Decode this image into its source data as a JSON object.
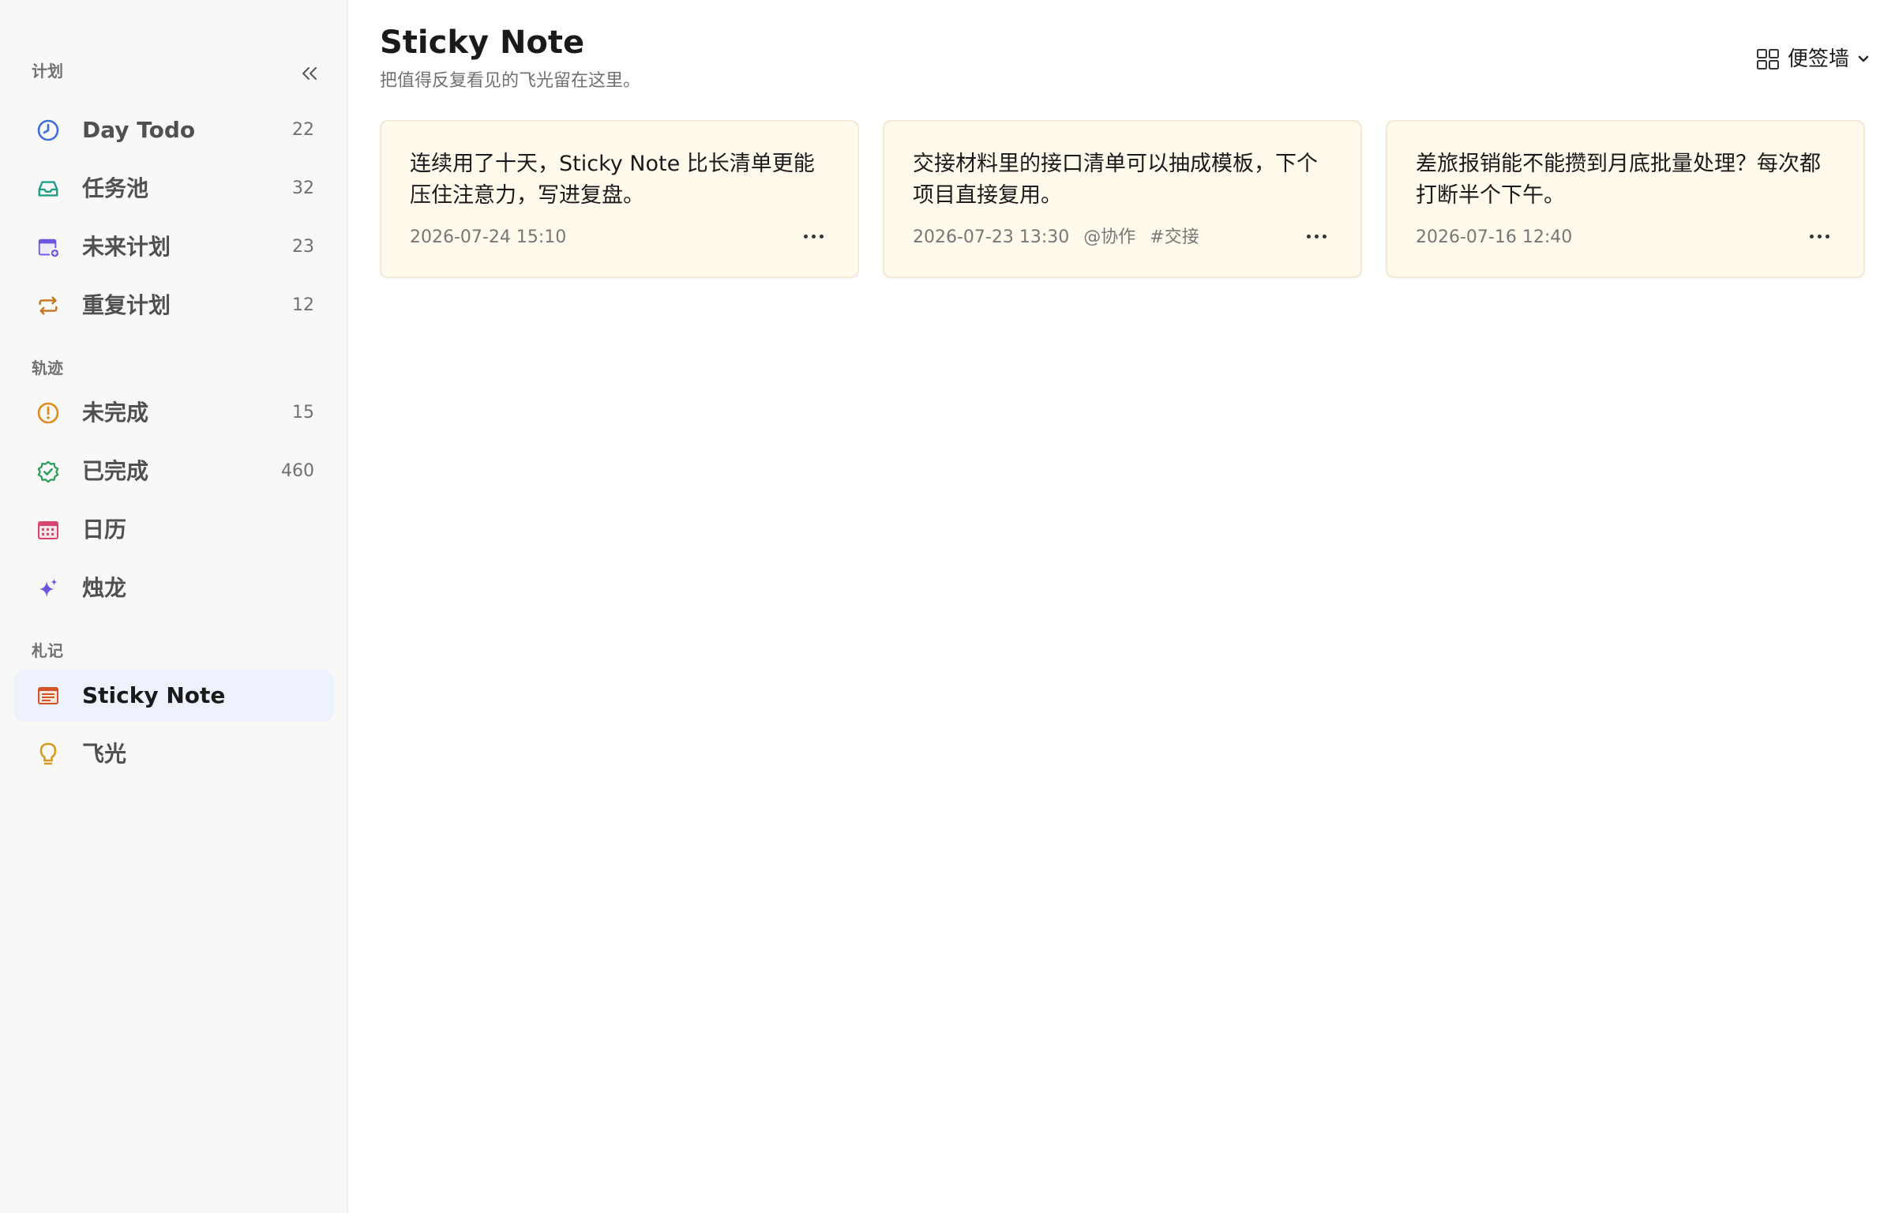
{
  "sidebar": {
    "sections": [
      {
        "label": "计划"
      },
      {
        "label": "轨迹"
      },
      {
        "label": "札记"
      }
    ],
    "items": [
      {
        "label": "Day Todo",
        "count": "22",
        "icon": "clock-icon",
        "color": "#3b6fd8"
      },
      {
        "label": "任务池",
        "count": "32",
        "icon": "inbox-icon",
        "color": "#1f9e86"
      },
      {
        "label": "未来计划",
        "count": "23",
        "icon": "calendar-plus-icon",
        "color": "#6c55e0"
      },
      {
        "label": "重复计划",
        "count": "12",
        "icon": "repeat-icon",
        "color": "#c9741c"
      },
      {
        "label": "未完成",
        "count": "15",
        "icon": "alert-circle-icon",
        "color": "#e08a1c"
      },
      {
        "label": "已完成",
        "count": "460",
        "icon": "check-badge-icon",
        "color": "#2a9c5a"
      },
      {
        "label": "日历",
        "count": "",
        "icon": "calendar-icon",
        "color": "#d6456b"
      },
      {
        "label": "烛龙",
        "count": "",
        "icon": "sparkle-icon",
        "color": "#6c55e0"
      },
      {
        "label": "Sticky Note",
        "count": "",
        "icon": "note-icon",
        "color": "#d2552a"
      },
      {
        "label": "飞光",
        "count": "",
        "icon": "lightbulb-icon",
        "color": "#d89a1c"
      }
    ]
  },
  "header": {
    "title": "Sticky Note",
    "subtitle": "把值得反复看见的飞光留在这里。",
    "view_label": "便签墙"
  },
  "cards": [
    {
      "text": "连续用了十天，Sticky Note 比长清单更能压住注意力，写进复盘。",
      "date": "2026-07-24 15:10",
      "tags": []
    },
    {
      "text": "交接材料里的接口清单可以抽成模板，下个项目直接复用。",
      "date": "2026-07-23 13:30",
      "tags": [
        "@协作",
        "#交接"
      ]
    },
    {
      "text": "差旅报销能不能攒到月底批量处理？每次都打断半个下午。",
      "date": "2026-07-16 12:40",
      "tags": []
    }
  ],
  "colors": {
    "sidebar_bg": "#f8f8f7",
    "active_bg": "#edf2fd",
    "card_bg": "#fffaec"
  }
}
